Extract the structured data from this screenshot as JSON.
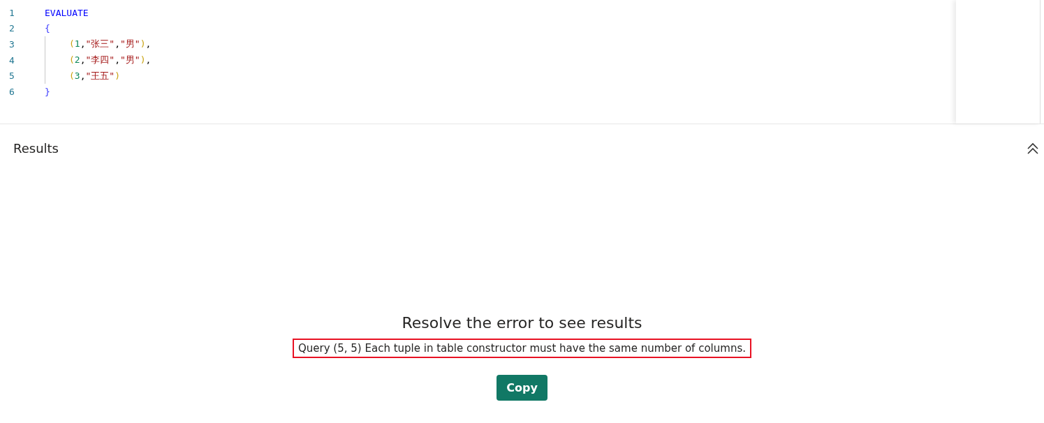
{
  "editor": {
    "lines": [
      {
        "number": "1",
        "indented": false,
        "tokens": [
          {
            "kind": "keyword",
            "text": "EVALUATE"
          }
        ]
      },
      {
        "number": "2",
        "indented": false,
        "tokens": [
          {
            "kind": "brace",
            "text": "{"
          }
        ]
      },
      {
        "number": "3",
        "indented": true,
        "tokens": [
          {
            "kind": "paren",
            "text": "("
          },
          {
            "kind": "number",
            "text": "1"
          },
          {
            "kind": "punct",
            "text": ","
          },
          {
            "kind": "string",
            "text": "\"张三\""
          },
          {
            "kind": "punct",
            "text": ","
          },
          {
            "kind": "string",
            "text": "\"男\""
          },
          {
            "kind": "paren",
            "text": ")"
          },
          {
            "kind": "punct",
            "text": ","
          }
        ]
      },
      {
        "number": "4",
        "indented": true,
        "tokens": [
          {
            "kind": "paren",
            "text": "("
          },
          {
            "kind": "number",
            "text": "2"
          },
          {
            "kind": "punct",
            "text": ","
          },
          {
            "kind": "string",
            "text": "\"李四\""
          },
          {
            "kind": "punct",
            "text": ","
          },
          {
            "kind": "string",
            "text": "\"男\""
          },
          {
            "kind": "paren",
            "text": ")"
          },
          {
            "kind": "punct",
            "text": ","
          }
        ]
      },
      {
        "number": "5",
        "indented": true,
        "tokens": [
          {
            "kind": "paren",
            "text": "("
          },
          {
            "kind": "number",
            "text": "3"
          },
          {
            "kind": "punct",
            "text": ","
          },
          {
            "kind": "string",
            "text": "\"王五\""
          },
          {
            "kind": "paren",
            "text": ")"
          }
        ]
      },
      {
        "number": "6",
        "indented": false,
        "tokens": [
          {
            "kind": "brace",
            "text": "}"
          }
        ]
      }
    ]
  },
  "results": {
    "title": "Results",
    "expanded": true,
    "error_title": "Resolve the error to see results",
    "error_message": "Query (5, 5) Each tuple in table constructor must have the same number of columns.",
    "highlighted": true,
    "button": "Copy"
  }
}
